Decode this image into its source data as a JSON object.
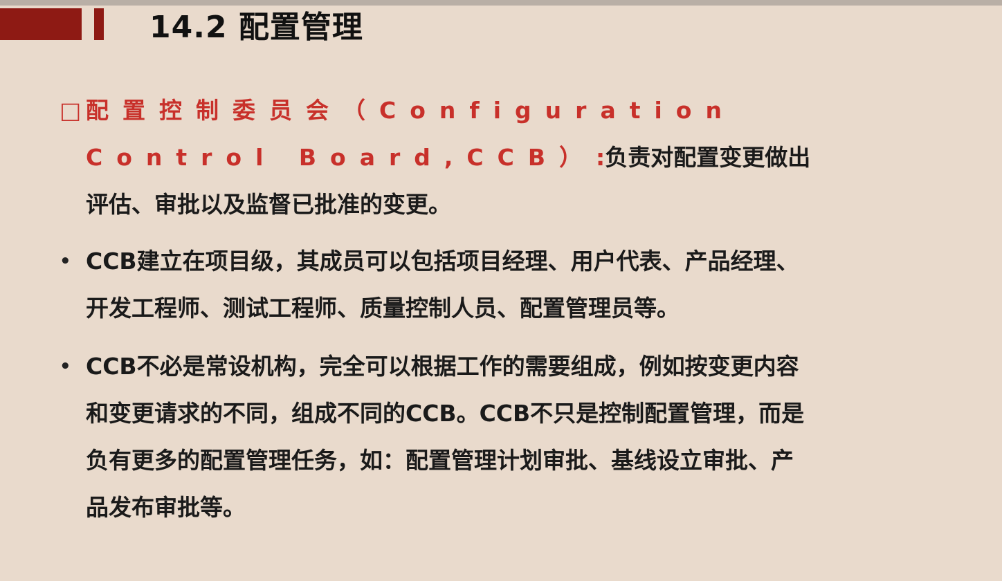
{
  "slide": {
    "title": "14.2 配置管理"
  },
  "items": [
    {
      "marker": "□",
      "term": "配置控制委员会（Configuration Control Board,CCB）",
      "separator": ":",
      "text": "负责对配置变更做出评估、审批以及监督已批准的变更。"
    },
    {
      "marker": "•",
      "text": "CCB建立在项目级，其成员可以包括项目经理、用户代表、产品经理、开发工程师、测试工程师、质量控制人员、配置管理员等。"
    },
    {
      "marker": "•",
      "text": "CCB不必是常设机构，完全可以根据工作的需要组成，例如按变更内容和变更请求的不同，组成不同的CCB。CCB不只是控制配置管理，而是负有更多的配置管理任务，如：配置管理计划审批、基线设立审批、产品发布审批等。"
    }
  ],
  "colors": {
    "background": "#e9dacc",
    "accent": "#8e1a14",
    "highlight": "#c8302a"
  }
}
